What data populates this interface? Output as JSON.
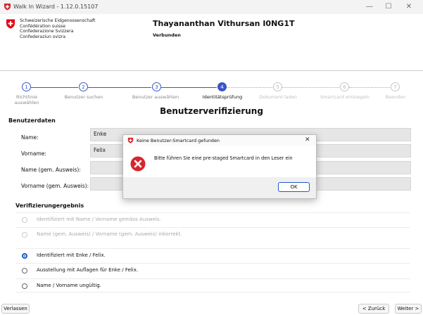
{
  "window": {
    "title": "Walk In Wizard - 1.12.0.15107",
    "minimize": "—",
    "maximize": "☐",
    "close": "✕"
  },
  "header": {
    "confederation_lines": [
      "Schweizerische Eidgenossenschaft",
      "Confédération suisse",
      "Confederazione Svizzera",
      "Confederaziun svizra"
    ],
    "user_name": "Thayananthan Vithursan I0NG1T",
    "connection_status": "Verbunden"
  },
  "stepper": {
    "steps": [
      {
        "number": "1",
        "label_line1": "Richtlinie",
        "label_line2": "auswählen",
        "state": "done"
      },
      {
        "number": "2",
        "label_line1": "Benutzer suchen",
        "label_line2": "",
        "state": "done"
      },
      {
        "number": "3",
        "label_line1": "Benutzer auswählen",
        "label_line2": "",
        "state": "done"
      },
      {
        "number": "4",
        "label_line1": "Identitätsprüfung",
        "label_line2": "",
        "state": "active"
      },
      {
        "number": "5",
        "label_line1": "Dokument laden",
        "label_line2": "",
        "state": "future"
      },
      {
        "number": "6",
        "label_line1": "Smartcard entsiegeln",
        "label_line2": "",
        "state": "future"
      },
      {
        "number": "7",
        "label_line1": "Beenden",
        "label_line2": "",
        "state": "future"
      }
    ]
  },
  "page": {
    "heading": "Benutzerverifizierung"
  },
  "user_data": {
    "section_title": "Benutzerdaten",
    "fields": [
      {
        "label": "Name:",
        "value": "Enke"
      },
      {
        "label": "Vorname:",
        "value": "Felix"
      },
      {
        "label": "Name (gem. Ausweis):",
        "value": ""
      },
      {
        "label": "Vorname (gem. Ausweis):",
        "value": ""
      }
    ]
  },
  "verification": {
    "section_title": "Verifizierungergebnis",
    "options": [
      {
        "label": "Identifiziert mit Name / Vorname gemäss Ausweis.",
        "enabled": false,
        "checked": false
      },
      {
        "label": "Name (gem. Ausweis) / Vorname (gem. Ausweis) inkorrekt.",
        "enabled": false,
        "checked": false
      },
      {
        "label": "Identifiziert mit Enke / Felix.",
        "enabled": true,
        "checked": true
      },
      {
        "label": "Ausstellung mit Auflagen für Enke / Felix.",
        "enabled": true,
        "checked": false
      },
      {
        "label": "Name / Vorname ungültig.",
        "enabled": true,
        "checked": false
      }
    ]
  },
  "footer": {
    "leave_label": "Verlassen",
    "back_label": "< Zurück",
    "next_label": "Weiter >"
  },
  "dialog": {
    "title": "Keine Benutzer-Smartcard gefunden",
    "message": "Bitte führen Sie eine pre-staged Smartcard in den Leser ein",
    "ok_label": "OK",
    "close": "✕"
  },
  "colors": {
    "accent": "#3b55c8",
    "error": "#d7262e",
    "swiss_red": "#e30613"
  }
}
